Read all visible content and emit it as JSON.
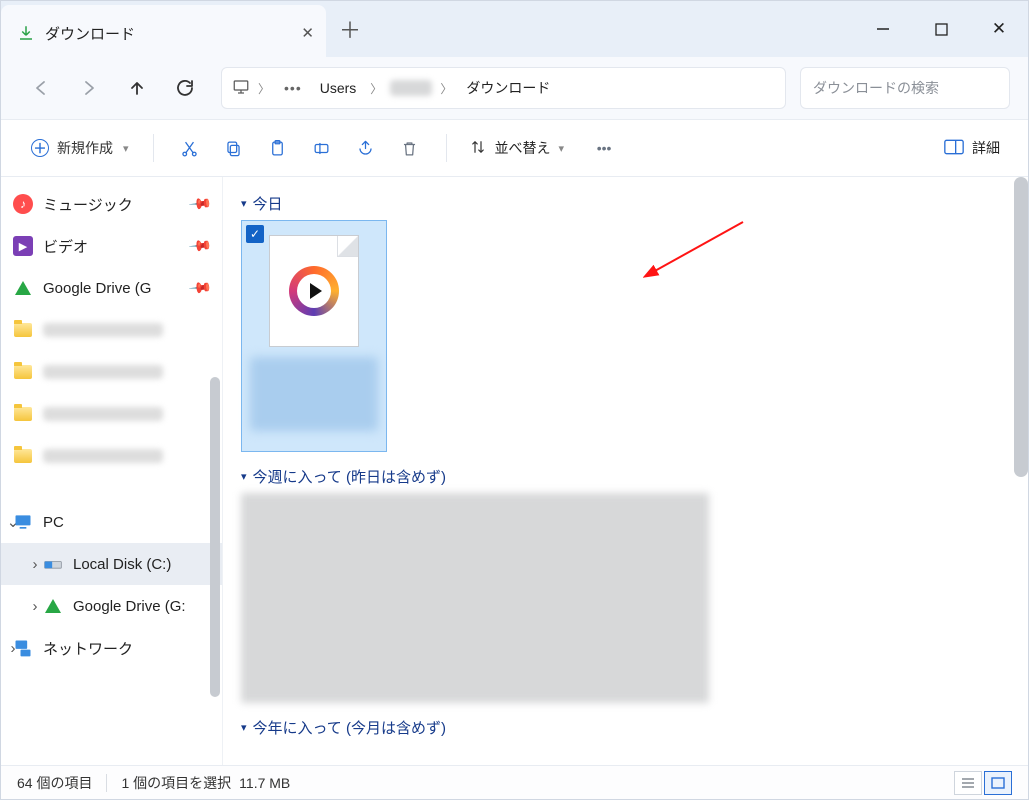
{
  "tab": {
    "title": "ダウンロード"
  },
  "crumbs": {
    "users": "Users",
    "downloads": "ダウンロード"
  },
  "search": {
    "placeholder": "ダウンロードの検索"
  },
  "toolbar": {
    "new_label": "新規作成",
    "sort_label": "並べ替え",
    "details_label": "詳細"
  },
  "sidebar": {
    "music": "ミュージック",
    "video": "ビデオ",
    "gdrive_pinned": "Google Drive (G",
    "pc": "PC",
    "local_disk": "Local Disk (C:)",
    "gdrive": "Google Drive (G:",
    "network": "ネットワーク"
  },
  "groups": {
    "today": "今日",
    "this_week": "今週に入って (昨日は含めず)",
    "this_year": "今年に入って (今月は含めず)"
  },
  "status": {
    "count": "64 個の項目",
    "selection": "1 個の項目を選択",
    "size": "11.7 MB"
  }
}
